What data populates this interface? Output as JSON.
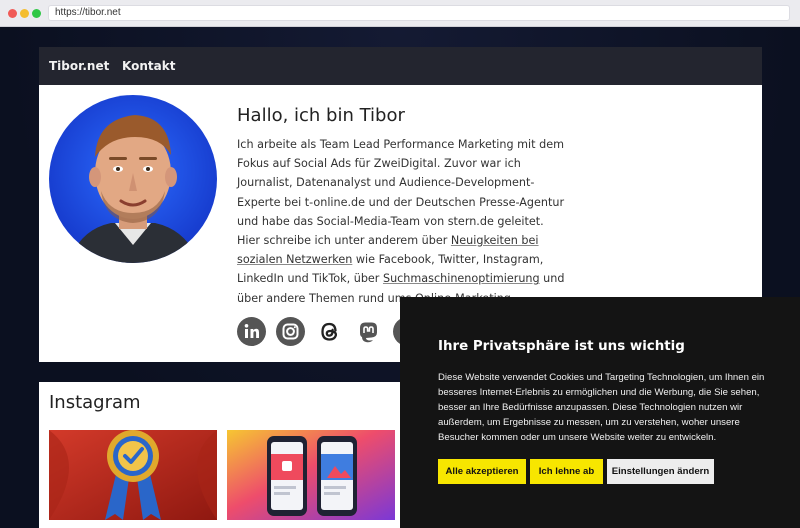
{
  "browser": {
    "url": "https://tibor.net"
  },
  "nav": {
    "brand": "Tibor.net",
    "contact": "Kontakt"
  },
  "hero": {
    "heading": "Hallo, ich bin Tibor",
    "bio_part1": "Ich arbeite als Team Lead Performance Marketing mit dem Fokus auf Social Ads für ZweiDigital. Zuvor war ich Journalist, Datenanalyst und Audience-Development-Experte bei t-online.de und der Deutschen Presse-Agentur und habe das Social-Media-Team von stern.de geleitet. Hier schreibe ich unter anderem über ",
    "bio_link1": "Neuigkeiten bei sozialen Netzwerken",
    "bio_part2": " wie Facebook, Twitter, Instagram, LinkedIn und TikTok, über ",
    "bio_link2": "Suchmaschinenoptimierung",
    "bio_part3": " und über andere Themen rund ums Online-Marketing.",
    "socials": [
      "linkedin-icon",
      "instagram-icon",
      "threads-icon",
      "mastodon-icon",
      "youtube-icon"
    ]
  },
  "instagram": {
    "heading": "Instagram"
  },
  "cookie": {
    "title": "Ihre Privatsphäre ist uns wichtig",
    "text": "Diese Website verwendet Cookies und Targeting Technologien, um Ihnen ein besseres Internet-Erlebnis zu ermöglichen und die Werbung, die Sie sehen, besser an Ihre Bedürfnisse anzupassen. Diese Technologien nutzen wir außerdem, um Ergebnisse zu messen, um zu verstehen, woher unsere Besucher kommen oder um unsere Website weiter zu entwickeln.",
    "accept": "Alle akzeptieren",
    "decline": "Ich lehne ab",
    "settings": "Einstellungen ändern"
  },
  "colors": {
    "nav_bg": "#23252f",
    "accent_yellow": "#f7e600",
    "banner_bg": "#141414",
    "avatar_bg": "#1f4fe0"
  }
}
